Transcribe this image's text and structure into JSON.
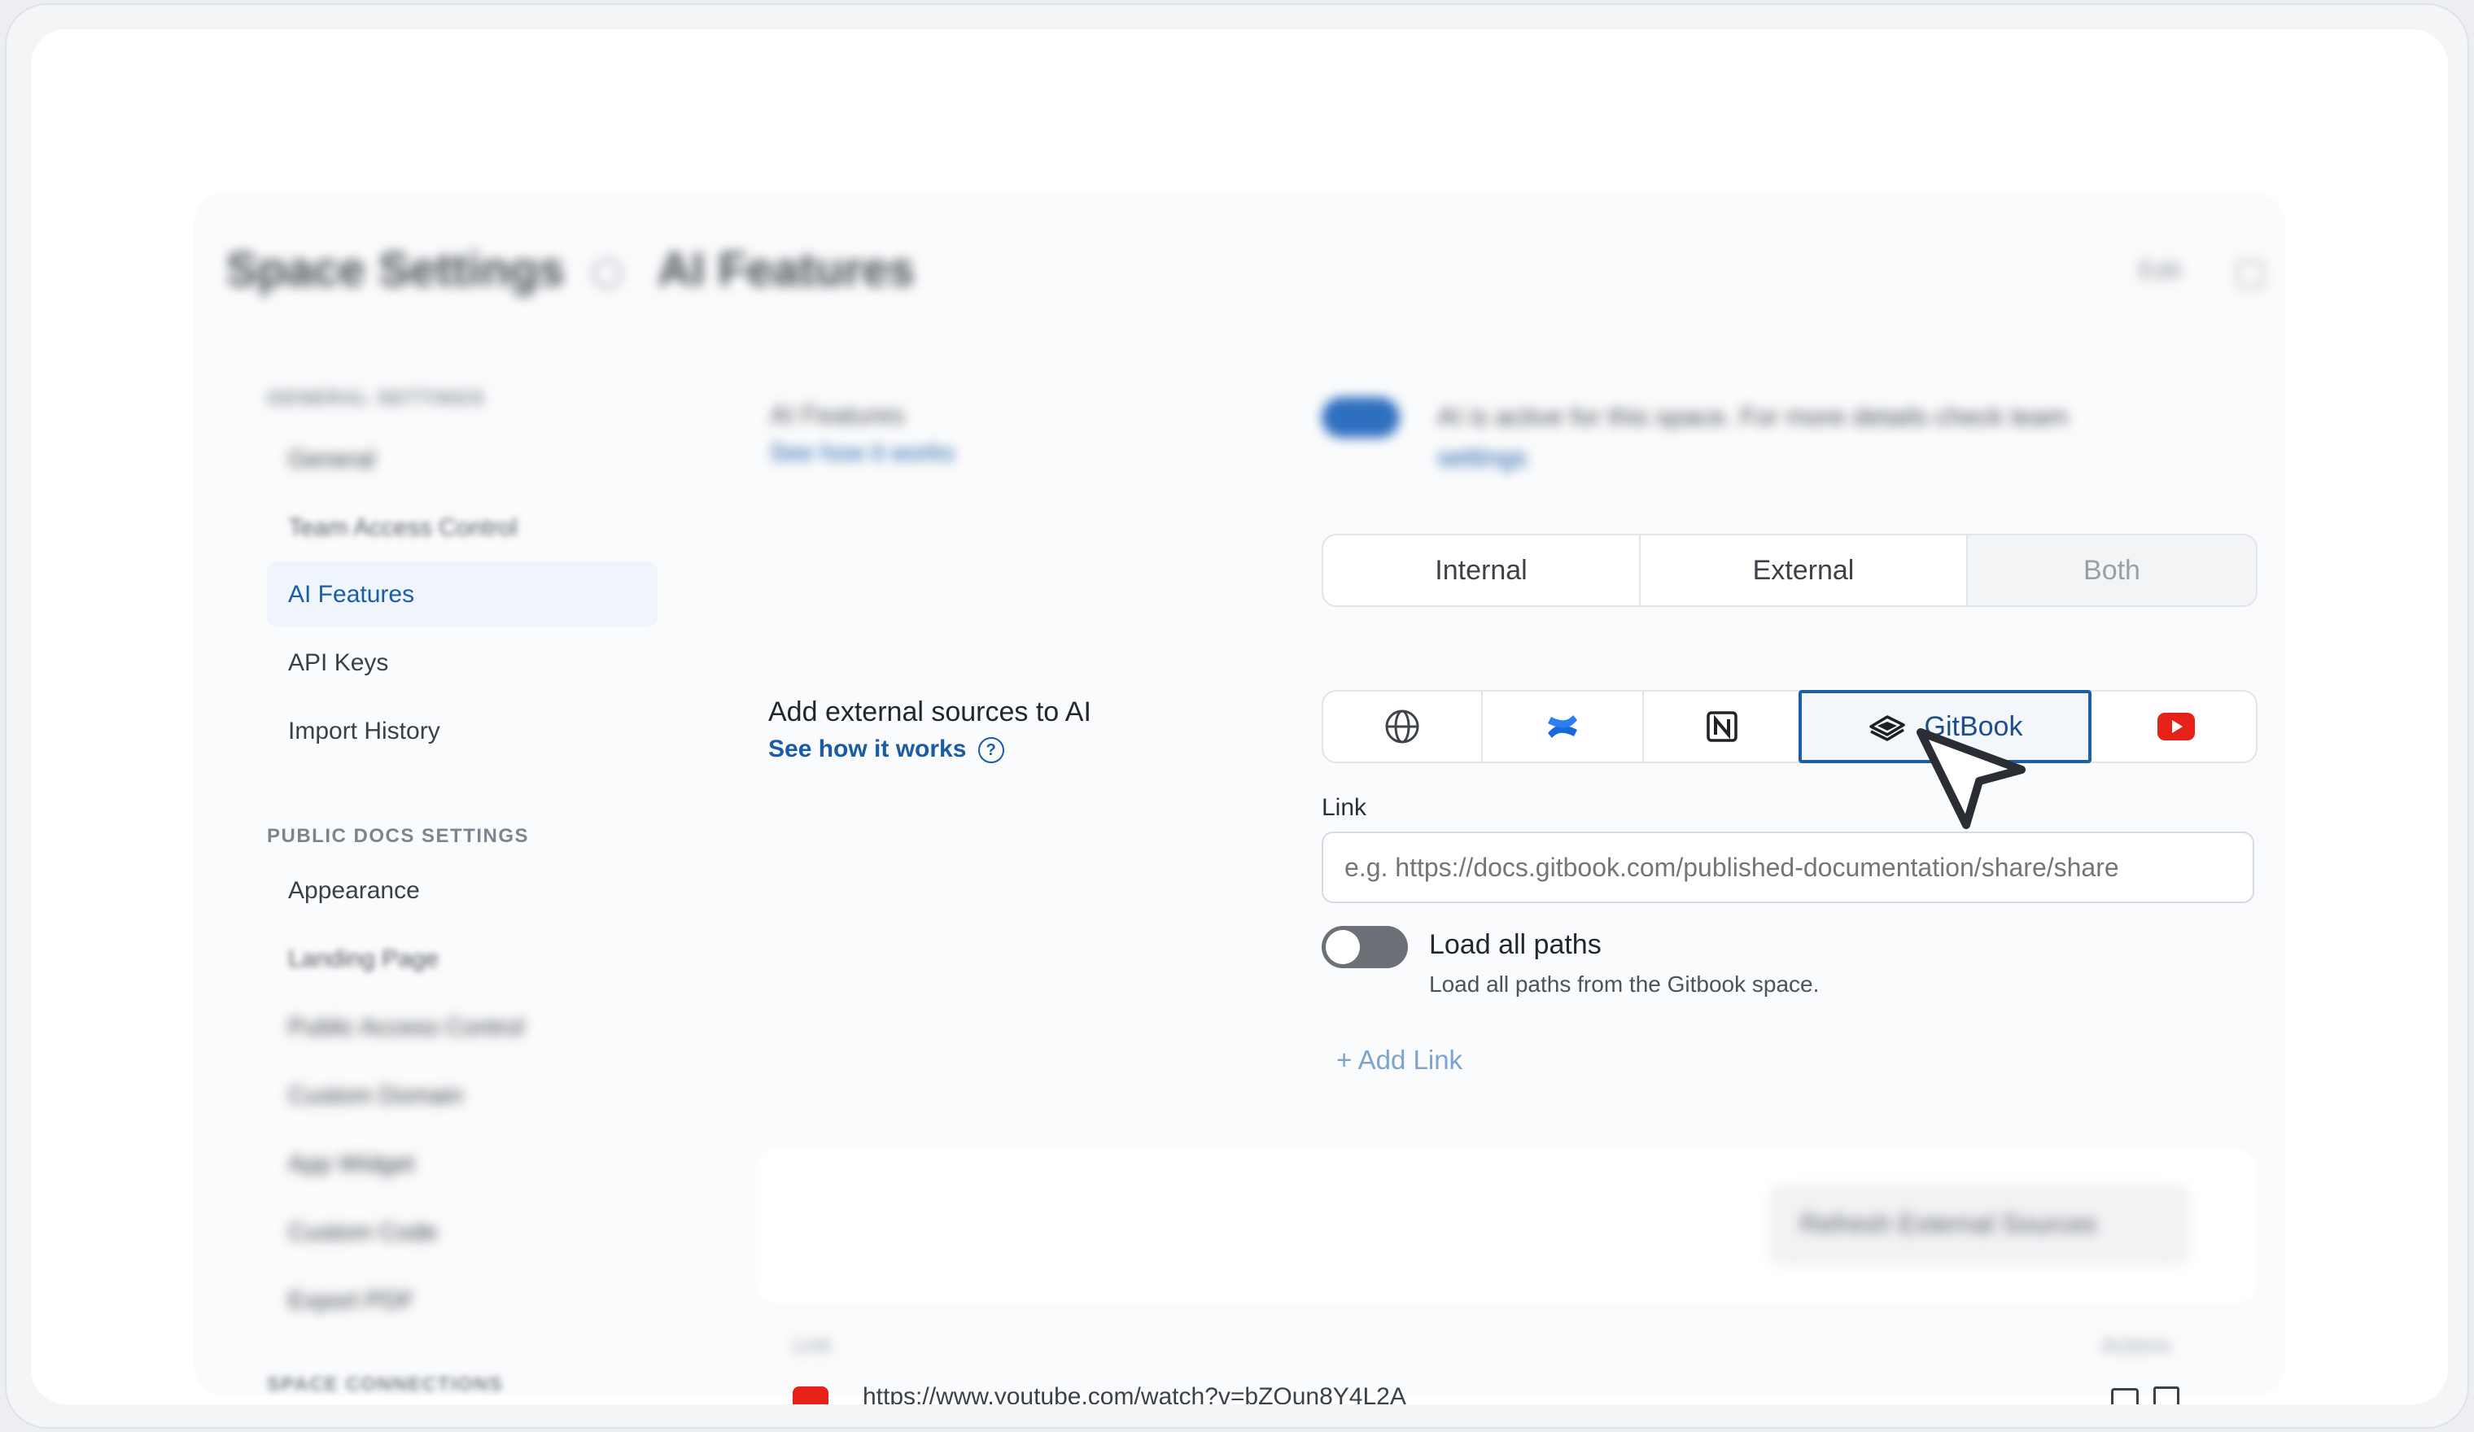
{
  "header": {
    "title": "Space Settings",
    "section": "AI Features",
    "right_label": "Edit"
  },
  "sidebar": {
    "general_heading": "GENERAL SETTINGS",
    "general_items": [
      {
        "label": "General"
      },
      {
        "label": "Team Access Control"
      },
      {
        "label": "AI Features",
        "active": true
      },
      {
        "label": "API Keys"
      },
      {
        "label": "Import History"
      }
    ],
    "public_heading": "PUBLIC DOCS SETTINGS",
    "public_items": [
      {
        "label": "Appearance"
      },
      {
        "label": "Landing Page"
      },
      {
        "label": "Public Access Control"
      },
      {
        "label": "Custom Domain"
      },
      {
        "label": "App Widget"
      },
      {
        "label": "Custom Code"
      },
      {
        "label": "Export PDF"
      }
    ],
    "connections_heading": "SPACE CONNECTIONS"
  },
  "ai_features": {
    "title": "AI Features",
    "how_link": "See how it works",
    "toggle_text": "AI is active for this space. For more details check team",
    "toggle_link": "settings",
    "enabled": true
  },
  "audience_tabs": {
    "options": [
      "Internal",
      "External",
      "Both"
    ],
    "selected": "Both"
  },
  "external_sources": {
    "title": "Add external sources to AI",
    "how_link": "See how it works",
    "sources": [
      {
        "icon": "globe-icon"
      },
      {
        "icon": "confluence-icon"
      },
      {
        "icon": "notion-icon"
      },
      {
        "icon": "gitbook-icon",
        "label": "GitBook",
        "selected": true
      },
      {
        "icon": "youtube-icon"
      }
    ],
    "link_label": "Link",
    "link_placeholder": "e.g. https://docs.gitbook.com/published-documentation/share/share",
    "load_all_label": "Load all paths",
    "load_all_desc": "Load all paths from the Gitbook space.",
    "load_all_on": false,
    "add_link": "+ Add Link"
  },
  "sources_table": {
    "refresh_button": "Refresh External Sources",
    "col_link": "Link",
    "col_actions": "Actions",
    "rows": [
      {
        "url": "https://www.youtube.com/watch?v=bZQun8Y4L2A"
      }
    ]
  },
  "colors": {
    "accent": "#1a5ba6",
    "youtube": "#e62117",
    "confluence": "#1868db"
  }
}
